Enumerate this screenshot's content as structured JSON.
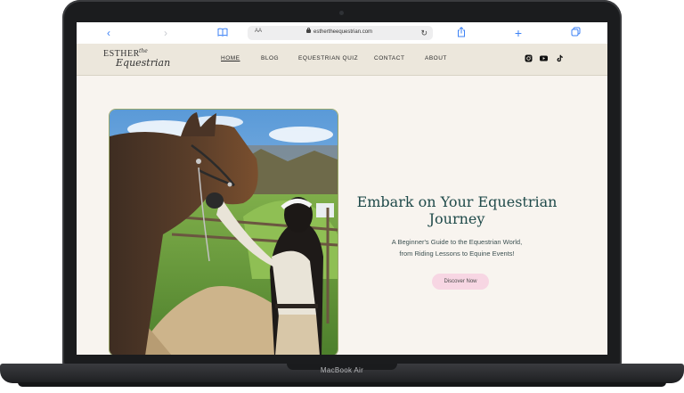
{
  "device": {
    "label": "MacBook Air"
  },
  "browser": {
    "text_size_label": "AA",
    "url": "esthertheequestrian.com",
    "icons": [
      "back-icon",
      "forward-icon",
      "reader-icon",
      "lock-icon",
      "reload-icon",
      "share-icon",
      "new-tab-icon",
      "tabs-icon"
    ]
  },
  "site": {
    "logo": {
      "top": "ESTHER",
      "the": "the",
      "bottom": "Equestrian"
    },
    "nav": [
      "HOME",
      "BLOG",
      "EQUESTRIAN QUIZ",
      "CONTACT",
      "ABOUT"
    ],
    "social_icons": [
      "instagram-icon",
      "youtube-icon",
      "tiktok-icon"
    ]
  },
  "hero": {
    "title_line1": "Embark on Your Equestrian",
    "title_line2": "Journey",
    "subtitle_line1": "A Beginner's Guide to the Equestrian World,",
    "subtitle_line2": "from Riding Lessons to Equine Events!",
    "cta_label": "Discover Now"
  },
  "colors": {
    "accent": "#3c82f6",
    "nav_bg": "#ece7dc",
    "page_bg": "#f8f4ef",
    "title": "#1f4a4a",
    "cta_bg": "#f7d6e3"
  }
}
